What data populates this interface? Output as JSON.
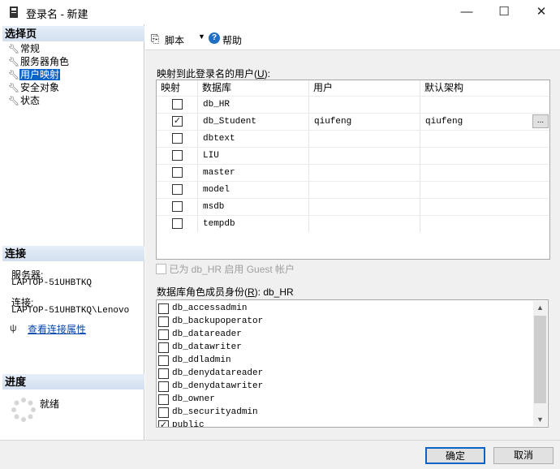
{
  "window": {
    "title": "登录名 - 新建",
    "minimize": "—",
    "maximize": "☐",
    "close": "✕"
  },
  "left": {
    "select_page": "选择页",
    "pages": [
      {
        "label": "常规",
        "icon": "wrench-icon"
      },
      {
        "label": "服务器角色",
        "icon": "wrench-icon"
      },
      {
        "label": "用户映射",
        "icon": "wrench-icon"
      },
      {
        "label": "安全对象",
        "icon": "wrench-icon"
      },
      {
        "label": "状态",
        "icon": "wrench-icon"
      }
    ],
    "connection": "连接",
    "server_label": "服务器:",
    "server_value": "LAPTOP-51UHBTKQ",
    "conn_label": "连接:",
    "conn_value": "LAPTOP-51UHBTKQ\\Lenovo",
    "view_conn_props": "查看连接属性",
    "progress": "进度",
    "progress_status": "就绪"
  },
  "toolbar": {
    "script": "脚本",
    "help": "帮助"
  },
  "mapping": {
    "label_a": "映射到此登录名的用户(",
    "label_key": "U",
    "label_b": "):",
    "headers": [
      "映射",
      "数据库",
      "用户",
      "默认架构"
    ],
    "rows": [
      {
        "db": "db_HR",
        "user": "",
        "schema": "",
        "mapped": false
      },
      {
        "db": "db_Student",
        "user": "qiufeng",
        "schema": "qiufeng",
        "mapped": true
      },
      {
        "db": "dbtext",
        "user": "",
        "schema": "",
        "mapped": false
      },
      {
        "db": "LIU",
        "user": "",
        "schema": "",
        "mapped": false
      },
      {
        "db": "master",
        "user": "",
        "schema": "",
        "mapped": false
      },
      {
        "db": "model",
        "user": "",
        "schema": "",
        "mapped": false
      },
      {
        "db": "msdb",
        "user": "",
        "schema": "",
        "mapped": false
      },
      {
        "db": "tempdb",
        "user": "",
        "schema": "",
        "mapped": false
      }
    ],
    "ellipsis": "..."
  },
  "guest": {
    "text": "已为 db_HR 启用 Guest 帐户",
    "checked": false
  },
  "roles": {
    "label_a": "数据库角色成员身份(",
    "label_key": "R",
    "label_b": "): db_HR",
    "items": [
      {
        "name": "db_accessadmin",
        "checked": false
      },
      {
        "name": "db_backupoperator",
        "checked": false
      },
      {
        "name": "db_datareader",
        "checked": false
      },
      {
        "name": "db_datawriter",
        "checked": false
      },
      {
        "name": "db_ddladmin",
        "checked": false
      },
      {
        "name": "db_denydatareader",
        "checked": false
      },
      {
        "name": "db_denydatawriter",
        "checked": false
      },
      {
        "name": "db_owner",
        "checked": false
      },
      {
        "name": "db_securityadmin",
        "checked": false
      },
      {
        "name": "public",
        "checked": true
      }
    ]
  },
  "footer": {
    "ok": "确定",
    "cancel": "取消"
  }
}
